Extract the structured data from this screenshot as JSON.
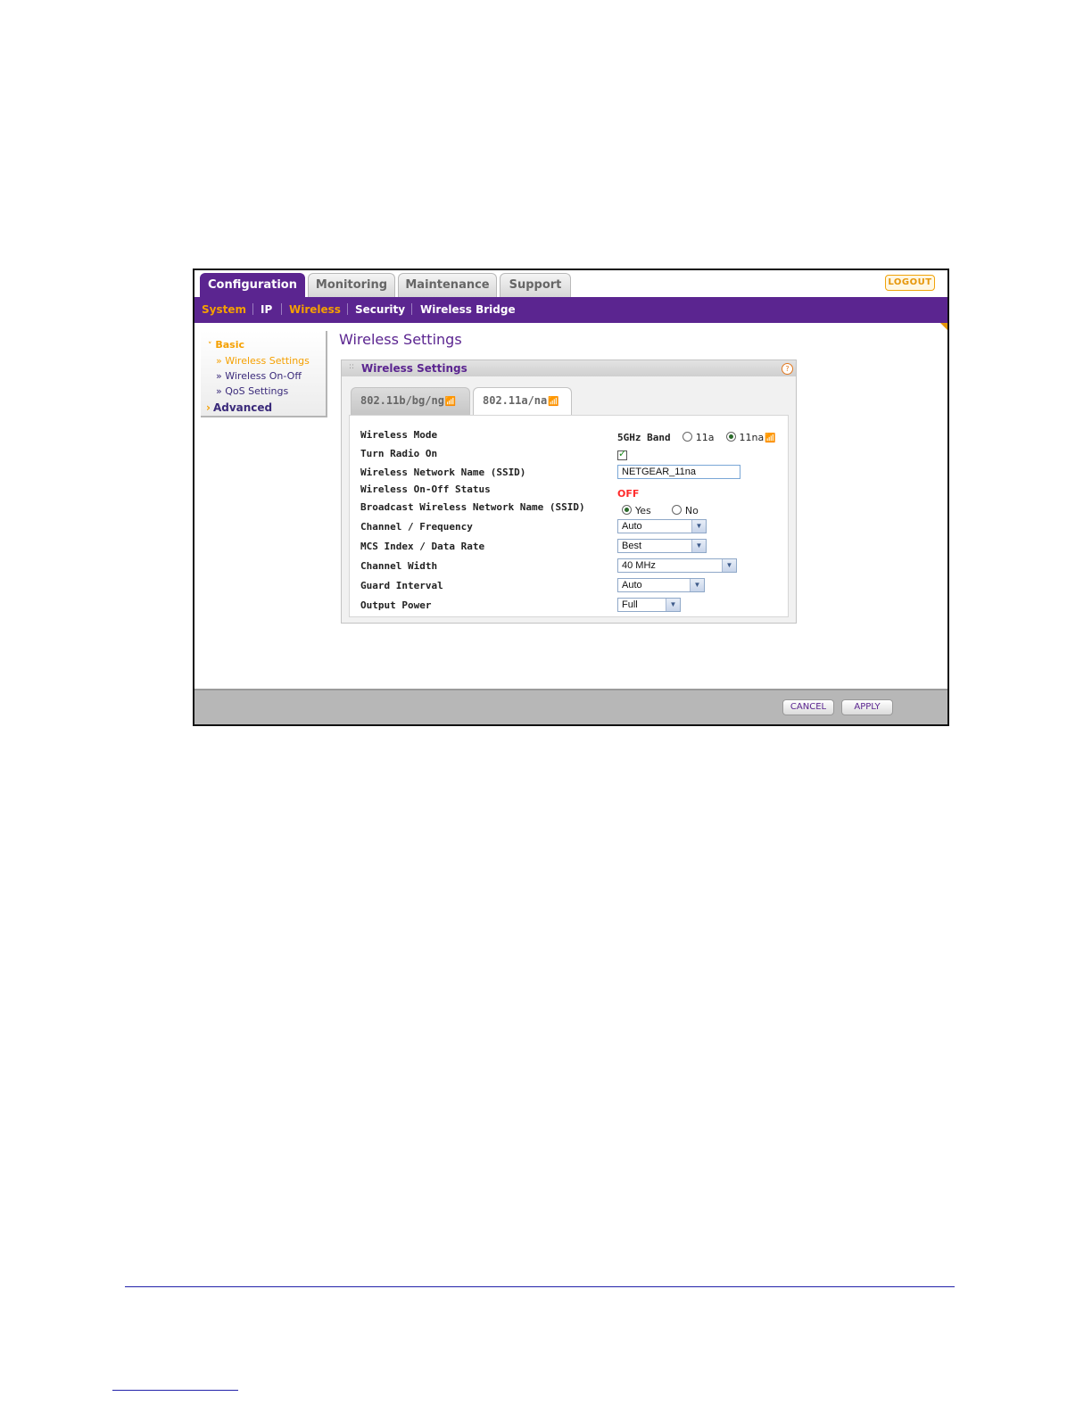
{
  "nav": {
    "tabs": [
      {
        "label": "Configuration",
        "active": true
      },
      {
        "label": "Monitoring",
        "active": false
      },
      {
        "label": "Maintenance",
        "active": false
      },
      {
        "label": "Support",
        "active": false
      }
    ],
    "logout": "LOGOUT",
    "subnav": [
      "System",
      "IP",
      "Wireless",
      "Security",
      "Wireless Bridge"
    ]
  },
  "sidebar": {
    "basic": "Basic",
    "items": [
      "Wireless Settings",
      "Wireless On-Off",
      "QoS Settings"
    ],
    "advanced": "Advanced"
  },
  "page_title": "Wireless Settings",
  "panel": {
    "title": "Wireless Settings",
    "help": "?",
    "tabs": [
      "802.11b/bg/ng",
      "802.11a/na"
    ]
  },
  "form": {
    "wireless_mode": {
      "label": "Wireless Mode",
      "band": "5GHz Band",
      "options": [
        "11a",
        "11na"
      ],
      "selected": "11na"
    },
    "turn_radio_on": {
      "label": "Turn Radio On",
      "checked": true
    },
    "ssid": {
      "label": "Wireless Network Name (SSID)",
      "value": "NETGEAR_11na"
    },
    "onoff_status": {
      "label": "Wireless On-Off Status",
      "value": "OFF"
    },
    "broadcast": {
      "label": "Broadcast Wireless Network Name (SSID)",
      "options": [
        "Yes",
        "No"
      ],
      "selected": "Yes"
    },
    "channel": {
      "label": "Channel / Frequency",
      "value": "Auto"
    },
    "mcs": {
      "label": "MCS Index / Data Rate",
      "value": "Best"
    },
    "width": {
      "label": "Channel Width",
      "value": "40 MHz"
    },
    "guard": {
      "label": "Guard Interval",
      "value": "Auto"
    },
    "power": {
      "label": "Output Power",
      "value": "Full"
    }
  },
  "footer": {
    "cancel": "CANCEL",
    "apply": "APPLY"
  },
  "colors": {
    "brand": "#5b2590",
    "accent": "#f5a000",
    "status_off": "#ff2a2a"
  }
}
